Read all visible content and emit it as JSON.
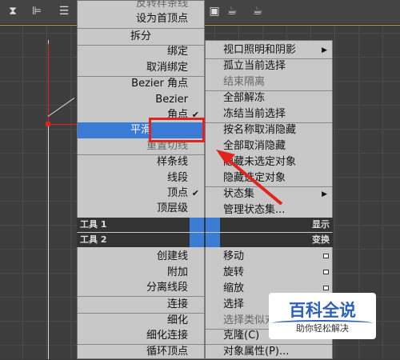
{
  "left_menu": {
    "items": [
      {
        "label": "反转样条线"
      },
      {
        "label": "设为首顶点"
      },
      {
        "label": "拆分"
      },
      {
        "label": "绑定"
      },
      {
        "label": "取消绑定"
      },
      {
        "label": "Bezier 角点"
      },
      {
        "label": "Bezier"
      },
      {
        "label": "角点"
      },
      {
        "label": "平滑"
      },
      {
        "label": "重置切线"
      },
      {
        "label": "样条线"
      },
      {
        "label": "线段"
      },
      {
        "label": "顶点"
      },
      {
        "label": "顶层级"
      },
      {
        "label": "创建线"
      },
      {
        "label": "附加"
      },
      {
        "label": "分离线段"
      },
      {
        "label": "连接"
      },
      {
        "label": "细化"
      },
      {
        "label": "细化连接"
      },
      {
        "label": "循环顶点"
      }
    ]
  },
  "right_menu": {
    "items": [
      {
        "label": "视口照明和阴影"
      },
      {
        "label": "孤立当前选择"
      },
      {
        "label": "结束隔离"
      },
      {
        "label": "全部解冻"
      },
      {
        "label": "冻结当前选择"
      },
      {
        "label": "按名称取消隐藏"
      },
      {
        "label": "全部取消隐藏"
      },
      {
        "label": "隐藏未选定对象"
      },
      {
        "label": "隐藏选定对象"
      },
      {
        "label": "状态集"
      },
      {
        "label": "管理状态集..."
      },
      {
        "label": "移动"
      },
      {
        "label": "旋转"
      },
      {
        "label": "缩放"
      },
      {
        "label": "选择"
      },
      {
        "label": "选择类似对象"
      },
      {
        "label": "克隆(C)"
      },
      {
        "label": "对象属性(P)..."
      }
    ]
  },
  "quad_headers": {
    "tools1": "工具 1",
    "tools2": "工具 2",
    "display": "显示",
    "transform": "变换"
  },
  "watermark": {
    "title": "百科全说",
    "subtitle": "助你轻松解决"
  },
  "colors": {
    "highlight": "#3a7bd5",
    "annotation_red": "#e0241e",
    "menu_bg": "#c8c8c8"
  }
}
